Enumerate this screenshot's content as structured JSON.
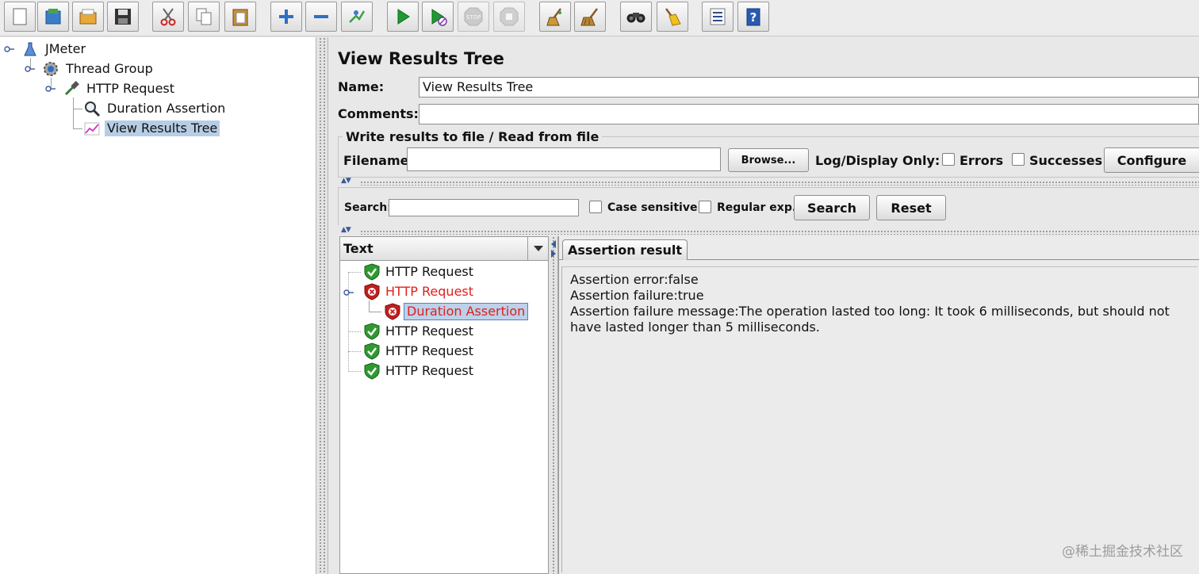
{
  "toolbar": {
    "buttons": [
      {
        "name": "new-icon"
      },
      {
        "name": "templates-icon"
      },
      {
        "name": "open-icon"
      },
      {
        "name": "save-icon"
      },
      {
        "name": "cut-icon"
      },
      {
        "name": "copy-icon"
      },
      {
        "name": "paste-icon"
      },
      {
        "name": "expand-icon"
      },
      {
        "name": "collapse-icon"
      },
      {
        "name": "toggle-icon"
      },
      {
        "name": "start-icon"
      },
      {
        "name": "start-no-pauses-icon"
      },
      {
        "name": "stop-icon"
      },
      {
        "name": "shutdown-icon"
      },
      {
        "name": "clear-icon"
      },
      {
        "name": "clear-all-icon"
      },
      {
        "name": "search-icon"
      },
      {
        "name": "reset-search-icon"
      },
      {
        "name": "function-helper-icon"
      },
      {
        "name": "help-icon"
      }
    ],
    "stop_text": "STOP"
  },
  "test_plan_tree": {
    "items": [
      {
        "label": "JMeter"
      },
      {
        "label": "Thread Group"
      },
      {
        "label": "HTTP Request"
      },
      {
        "label": "Duration Assertion"
      },
      {
        "label": "View Results Tree"
      }
    ]
  },
  "panel": {
    "title": "View Results Tree",
    "name_label": "Name:",
    "name_value": "View Results Tree",
    "comments_label": "Comments:",
    "comments_value": "",
    "file_group_title": "Write results to file / Read from file",
    "filename_label": "Filename",
    "filename_value": "",
    "browse_label": "Browse...",
    "log_display_label": "Log/Display Only:",
    "errors_label": "Errors",
    "successes_label": "Successes",
    "configure_label": "Configure"
  },
  "search": {
    "label": "Search:",
    "value": "",
    "case_sensitive_label": "Case sensitive",
    "regex_label": "Regular exp.",
    "search_button": "Search",
    "reset_button": "Reset"
  },
  "results": {
    "renderer": "Text",
    "items": [
      {
        "label": "HTTP Request",
        "status": "pass"
      },
      {
        "label": "HTTP Request",
        "status": "fail"
      },
      {
        "label": "Duration Assertion",
        "status": "fail"
      },
      {
        "label": "HTTP Request",
        "status": "pass"
      },
      {
        "label": "HTTP Request",
        "status": "pass"
      },
      {
        "label": "HTTP Request",
        "status": "pass"
      }
    ]
  },
  "detail": {
    "tab_label": "Assertion result",
    "lines": [
      "Assertion error:false",
      "Assertion failure:true",
      "Assertion failure message:The operation lasted too long: It took 6 milliseconds, but should not have lasted longer than 5 milliseconds."
    ]
  },
  "watermark": "@稀土掘金技术社区",
  "colors": {
    "fail_text": "#e0201a",
    "selection": "#b7cde6",
    "pass_shield": "#2f9a2f",
    "fail_shield": "#c41e1e"
  }
}
